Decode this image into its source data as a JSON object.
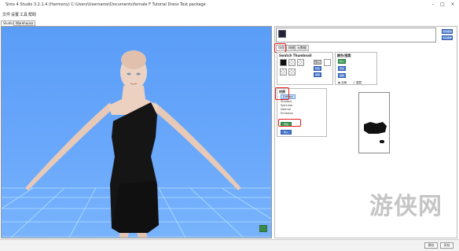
{
  "window": {
    "title": "Sims 4 Studio 3.2.1.4 (Harmony)  C:\\Users\\Username\\Documents\\female F Tutorial Dress Test.package",
    "controls": [
      "minimize-icon",
      "maximize-icon",
      "close-icon"
    ]
  },
  "menu": {
    "items": [
      "文件",
      "设置",
      "工具",
      "帮助"
    ]
  },
  "tabs": [
    "Studio",
    "Warehouse"
  ],
  "panel": {
    "thumb_buttons": [
      "替换图像",
      "导出图像"
    ],
    "subtabs": [
      "纹理",
      "网格",
      "元数据"
    ],
    "swatch": {
      "title": "Swatch Thumbnail",
      "buttons": [
        "导入",
        "导出",
        "编辑"
      ]
    },
    "variant": {
      "title": "颜色/图案",
      "buttons": [
        "导入",
        "导出",
        "编辑"
      ],
      "radio_label_a": "全局",
      "radio_label_b": "图层"
    },
    "materials": {
      "title": "材质",
      "items": [
        "Diffuse",
        "Shadow",
        "Specular",
        "Normal",
        "Emission"
      ],
      "selected": "Diffuse",
      "import_label": "导出",
      "export_label": "导入"
    }
  },
  "status": {
    "save_label": "保存",
    "save_as_label": "另存"
  },
  "watermark": "游侠网",
  "colors": {
    "viewport_sky": "#5a9df8",
    "grid": "#b7e7ff",
    "dress": "#151515",
    "highlight": "#e21a1a"
  }
}
